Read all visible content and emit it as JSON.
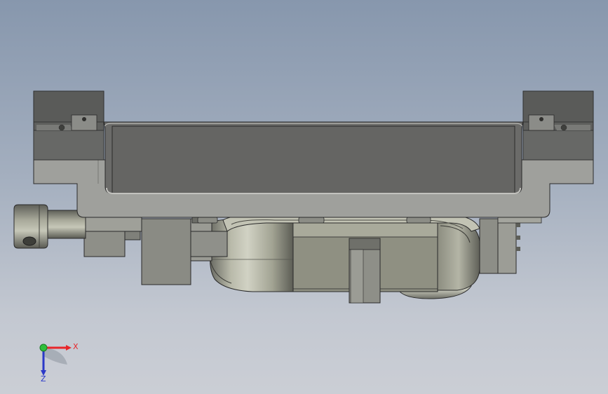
{
  "viewport": {
    "background_top": "#8797ad",
    "background_bottom": "#cbced5"
  },
  "triad": {
    "x_label": "X",
    "z_label": "Z",
    "x_color": "#e8262a",
    "y_color": "#2fbf3a",
    "z_color": "#2b39c8"
  },
  "model": {
    "description_icon": "cad-part-icon"
  }
}
